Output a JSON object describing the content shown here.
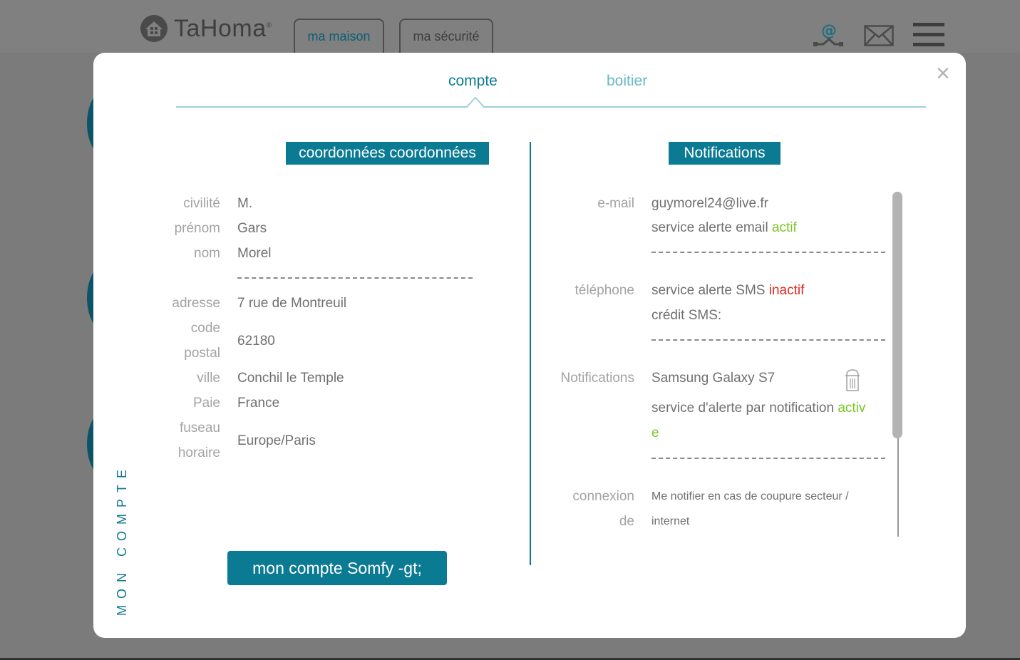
{
  "app": {
    "logo_text": "TaHoma",
    "logo_reg": "®",
    "tabs": [
      "ma maison",
      "ma sécurité"
    ]
  },
  "modal": {
    "side_label": "MON COMPTE",
    "close": "×",
    "tabs": {
      "compte": "compte",
      "boitier": "boitier"
    },
    "left": {
      "title": "coordonnées coordonnées",
      "civilite_label": "civilité",
      "civilite": "M.",
      "prenom_label": "prénom",
      "prenom": "Gars",
      "nom_label": "nom",
      "nom": "Morel",
      "adresse_label": "adresse",
      "adresse": "7 rue de Montreuil",
      "code_label_1": "code",
      "code_label_2": "postal",
      "code": "62180",
      "ville_label": "ville",
      "ville": "Conchil le Temple",
      "pays_label": "Paie",
      "pays": "France",
      "fuseau_label_1": "fuseau",
      "fuseau_label_2": "horaire",
      "fuseau": "Europe/Paris",
      "button": "mon compte Somfy -gt;"
    },
    "right": {
      "title": "Notifications",
      "email_label": "e-mail",
      "email": "guymorel24@live.fr",
      "email_alert": "service alerte email ",
      "email_status": "actif",
      "tel_label": "téléphone",
      "sms_alert": "service alerte SMS ",
      "sms_status": "inactif",
      "sms_credit": "crédit SMS:",
      "notif_label": "Notifications",
      "device": "Samsung Galaxy S7",
      "notif_alert": "service d'alerte par notification ",
      "notif_status_1": "activ",
      "notif_status_2": "e",
      "conn_label_1": "connexion",
      "conn_label_2": "de",
      "conn_text_1": "Me notifier en cas de coupure secteur /",
      "conn_text_2": "internet"
    }
  },
  "colors": {
    "accent": "#0b7a93",
    "active": "#7ac524",
    "inactive": "#e02a1e"
  }
}
